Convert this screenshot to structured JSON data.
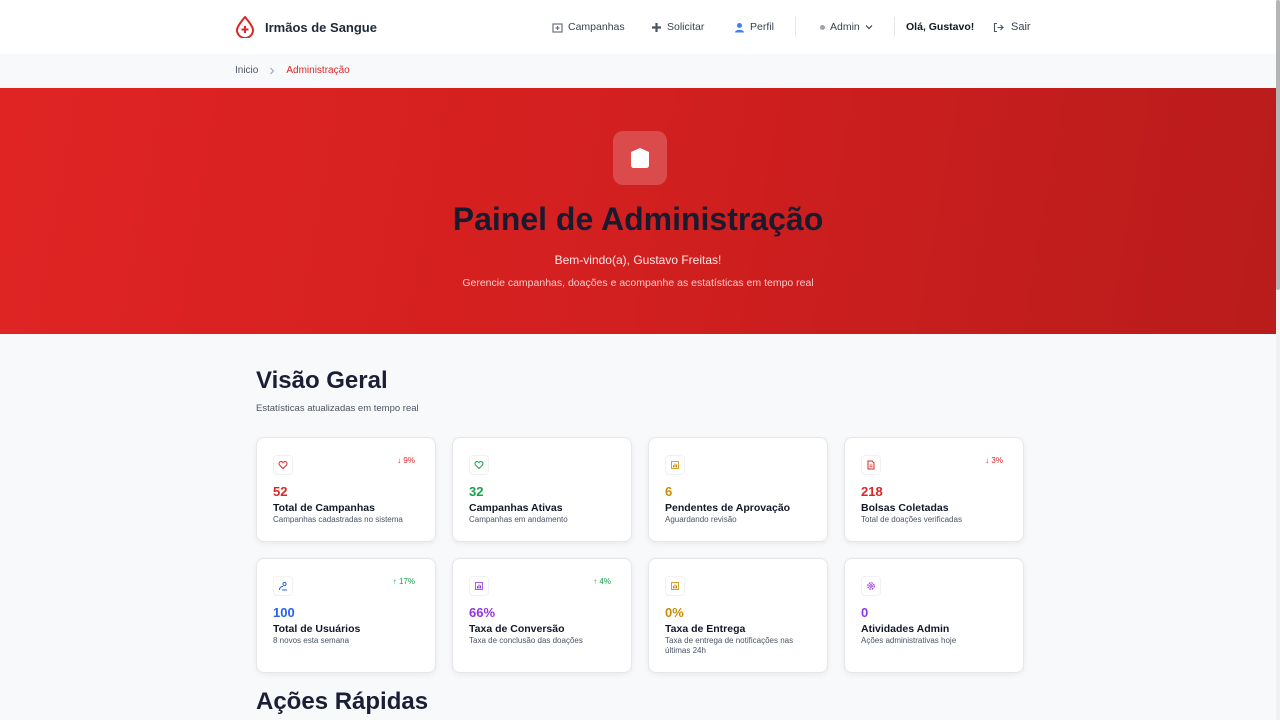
{
  "header": {
    "brand": "Irmãos de Sangue",
    "nav": {
      "campanhas": "Campanhas",
      "solicitar": "Solicitar",
      "perfil": "Perfil",
      "admin": "Admin",
      "greeting": "Olá, Gustavo!",
      "sair": "Sair"
    }
  },
  "breadcrumb": {
    "home": "Inicio",
    "current": "Administração"
  },
  "hero": {
    "title": "Painel de Administração",
    "welcome": "Bem-vindo(a), Gustavo Freitas!",
    "subtitle": "Gerencie campanhas, doações e acompanhe as estatísticas em tempo real"
  },
  "overview": {
    "title": "Visão Geral",
    "subtitle": "Estatísticas atualizadas em tempo real",
    "cards": [
      {
        "value": "52",
        "label": "Total de Campanhas",
        "desc": "Campanhas cadastradas no sistema",
        "trend": "↓ 9%",
        "color": "#dc2626",
        "trend_color": "#dc2626",
        "icon": "heart-icon"
      },
      {
        "value": "32",
        "label": "Campanhas Ativas",
        "desc": "Campanhas em andamento",
        "trend": "",
        "color": "#16a34a",
        "trend_color": "#16a34a",
        "icon": "heart-icon"
      },
      {
        "value": "6",
        "label": "Pendentes de Aprovação",
        "desc": "Aguardando revisão",
        "trend": "",
        "color": "#ca8a04",
        "trend_color": "#ca8a04",
        "icon": "bar-chart-icon"
      },
      {
        "value": "218",
        "label": "Bolsas Coletadas",
        "desc": "Total de doações verificadas",
        "trend": "↓ 3%",
        "color": "#dc2626",
        "trend_color": "#dc2626",
        "icon": "document-icon"
      },
      {
        "value": "100",
        "label": "Total de Usuários",
        "desc": "8 novos esta semana",
        "trend": "↑ 17%",
        "color": "#2563eb",
        "trend_color": "#16a34a",
        "icon": "users-icon"
      },
      {
        "value": "66%",
        "label": "Taxa de Conversão",
        "desc": "Taxa de conclusão das doações",
        "trend": "↑ 4%",
        "color": "#9333ea",
        "trend_color": "#16a34a",
        "icon": "bar-chart-icon"
      },
      {
        "value": "0%",
        "label": "Taxa de Entrega",
        "desc": "Taxa de entrega de notificações nas últimas 24h",
        "trend": "",
        "color": "#ca8a04",
        "trend_color": "#ca8a04",
        "icon": "bar-chart-icon"
      },
      {
        "value": "0",
        "label": "Atividades Admin",
        "desc": "Ações administrativas hoje",
        "trend": "",
        "color": "#9333ea",
        "trend_color": "#9333ea",
        "icon": "gear-icon"
      }
    ]
  },
  "quick_actions": {
    "title": "Ações Rápidas"
  }
}
